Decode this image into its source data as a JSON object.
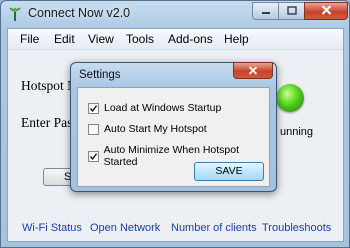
{
  "window": {
    "title": "Connect Now v2.0",
    "icons": {
      "app": "antenna-icon",
      "minimize": "minimize-icon",
      "maximize": "maximize-icon",
      "close": "close-icon"
    }
  },
  "menu": {
    "items": [
      "File",
      "Edit",
      "View",
      "Tools",
      "Add-ons",
      "Help"
    ]
  },
  "main": {
    "hotspot_label": "Hotspot N",
    "password_label": "Enter Pas",
    "status_text": "unning",
    "start_button_label": "S",
    "status_light_color": "#54d11e"
  },
  "bottom_links": [
    "Wi-Fi Status",
    "Open Network",
    "Number of clients",
    "Troubleshoots"
  ],
  "settings_dialog": {
    "title": "Settings",
    "options": [
      {
        "label": "Load at Windows Startup",
        "checked": true
      },
      {
        "label": "Auto Start My Hotspot",
        "checked": false
      },
      {
        "label": "Auto Minimize When Hotspot Started",
        "checked": true
      }
    ],
    "save_label": "SAVE"
  },
  "colors": {
    "link": "#1c3fa8",
    "close_button": "#c7432a",
    "frame": "#a6c3de"
  }
}
